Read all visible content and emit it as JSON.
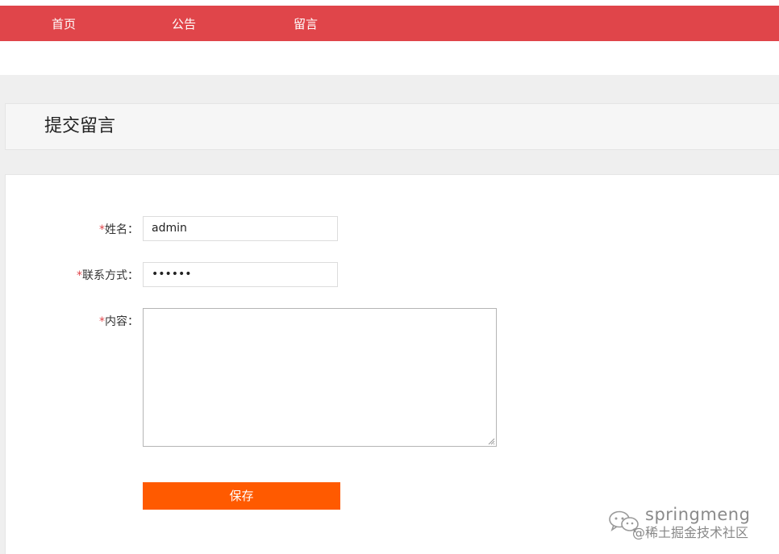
{
  "nav": {
    "items": [
      {
        "label": "首页"
      },
      {
        "label": "公告"
      },
      {
        "label": "留言"
      }
    ]
  },
  "page": {
    "title": "提交留言"
  },
  "form": {
    "required_mark": "*",
    "name": {
      "label": "姓名：",
      "value": "admin"
    },
    "contact": {
      "label": "联系方式：",
      "value": "••••••"
    },
    "content": {
      "label": "内容：",
      "value": ""
    },
    "save_label": "保存"
  },
  "watermark": {
    "name": "springmeng",
    "site": "@稀土掘金技术社区"
  },
  "colors": {
    "nav_bg": "#e0454a",
    "save_button": "#ff5a00",
    "required": "#e0454a"
  }
}
